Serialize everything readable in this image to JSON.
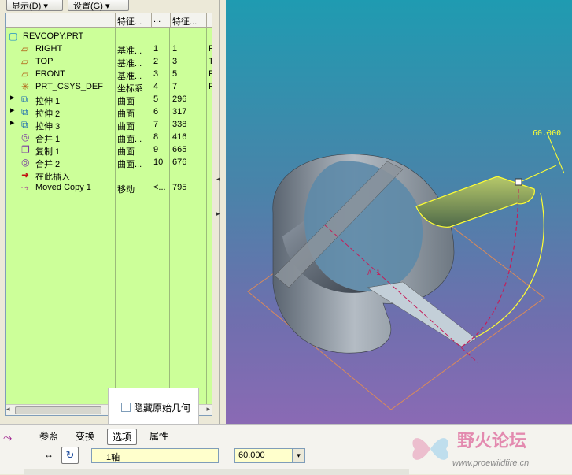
{
  "toolbar": {
    "show_label": "显示",
    "show_key": "(D)",
    "settings_label": "设置",
    "settings_key": "(G)"
  },
  "tree": {
    "headers": [
      "",
      "特征...",
      "...",
      "特征..."
    ],
    "rows": [
      {
        "name": "REVCOPY.PRT",
        "type": "",
        "num": "",
        "id": "",
        "extra": "",
        "icon": "part-icon",
        "indent": 0,
        "expandable": false
      },
      {
        "name": "RIGHT",
        "type": "基准...",
        "num": "1",
        "id": "1",
        "extra": "F",
        "icon": "datum-plane-icon",
        "indent": 1,
        "expandable": false
      },
      {
        "name": "TOP",
        "type": "基准...",
        "num": "2",
        "id": "3",
        "extra": "T",
        "icon": "datum-plane-icon",
        "indent": 1,
        "expandable": false
      },
      {
        "name": "FRONT",
        "type": "基准...",
        "num": "3",
        "id": "5",
        "extra": "F",
        "icon": "datum-plane-icon",
        "indent": 1,
        "expandable": false
      },
      {
        "name": "PRT_CSYS_DEF",
        "type": "坐标系",
        "num": "4",
        "id": "7",
        "extra": "F",
        "icon": "csys-icon",
        "indent": 1,
        "expandable": false
      },
      {
        "name": "拉伸 1",
        "type": "曲面",
        "num": "5",
        "id": "296",
        "extra": "",
        "icon": "extrude-icon",
        "indent": 1,
        "expandable": true
      },
      {
        "name": "拉伸 2",
        "type": "曲面",
        "num": "6",
        "id": "317",
        "extra": "",
        "icon": "extrude-icon",
        "indent": 1,
        "expandable": true
      },
      {
        "name": "拉伸 3",
        "type": "曲面",
        "num": "7",
        "id": "338",
        "extra": "",
        "icon": "extrude-icon",
        "indent": 1,
        "expandable": true
      },
      {
        "name": "合并 1",
        "type": "曲面...",
        "num": "8",
        "id": "416",
        "extra": "",
        "icon": "merge-icon",
        "indent": 1,
        "expandable": false
      },
      {
        "name": "复制 1",
        "type": "曲面",
        "num": "9",
        "id": "665",
        "extra": "",
        "icon": "copy-icon",
        "indent": 1,
        "expandable": false
      },
      {
        "name": "合并 2",
        "type": "曲面...",
        "num": "10",
        "id": "676",
        "extra": "",
        "icon": "merge-icon",
        "indent": 1,
        "expandable": false
      },
      {
        "name": "在此插入",
        "type": "",
        "num": "",
        "id": "",
        "extra": "",
        "icon": "insert-here-icon",
        "indent": 1,
        "expandable": false
      },
      {
        "name": "Moved Copy 1",
        "type": "移动",
        "num": "<...",
        "id": "795",
        "extra": "",
        "icon": "moved-copy-icon",
        "indent": 1,
        "expandable": false
      }
    ]
  },
  "viewport": {
    "dimension_label": "60.000",
    "axis_label": "A_1"
  },
  "popup": {
    "hide_original_label": "隐藏原始几何",
    "hide_original_checked": false
  },
  "dashboard": {
    "tabs": [
      "参照",
      "变换",
      "选项",
      "属性"
    ],
    "active_tab": "选项",
    "reference_value": "1轴",
    "angle_value": "60.000"
  },
  "watermark": {
    "title": "野火论坛",
    "url": "www.proewildfire.cn"
  },
  "colors": {
    "tree_bg": "#ccff99",
    "viewport_top": "#1f9bb1",
    "viewport_bottom": "#8a6ab4",
    "highlight_yellow": "#ffff33"
  }
}
